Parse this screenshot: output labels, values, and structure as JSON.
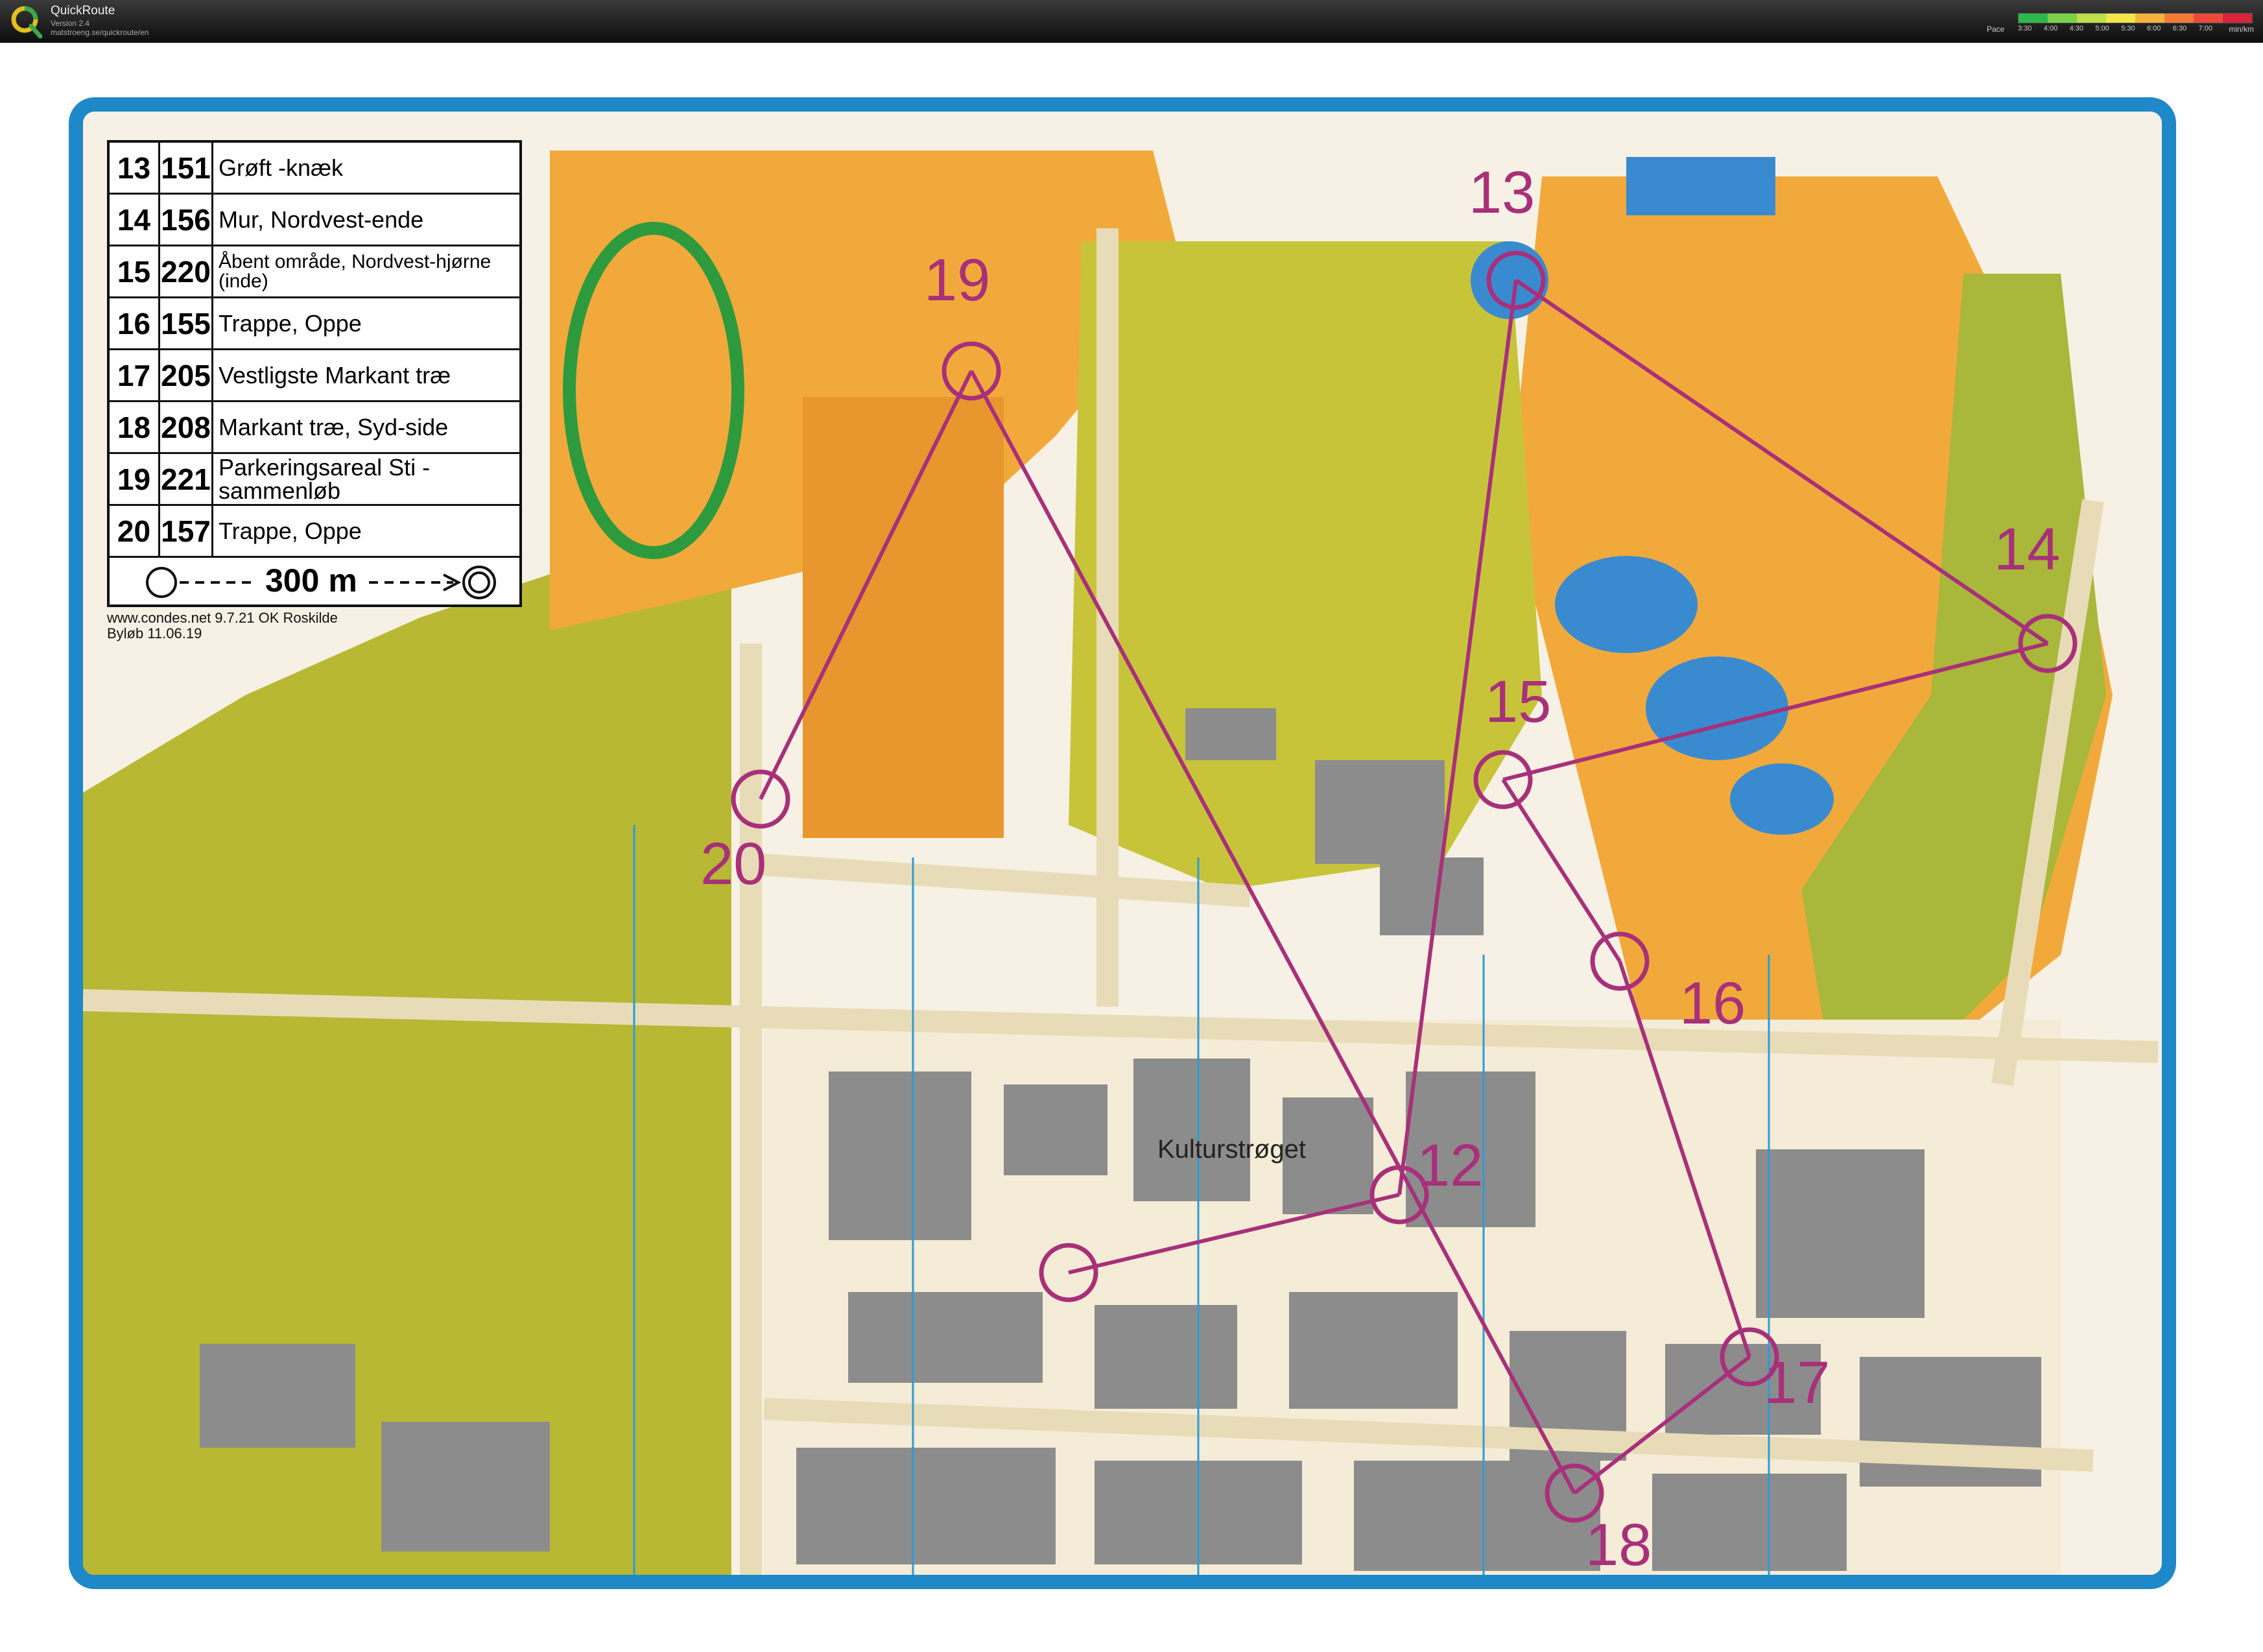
{
  "app": {
    "title": "QuickRoute",
    "version": "Version 2.4",
    "url": "matstroeng.se/quickroute/en"
  },
  "pace_legend": {
    "label": "Pace",
    "ticks": [
      "3:30",
      "4:00",
      "4:30",
      "5:00",
      "5:30",
      "6:00",
      "6:30",
      "7:00"
    ],
    "unit": "min/km",
    "colors": [
      "#2db84d",
      "#7ad14a",
      "#bde04a",
      "#f2e64a",
      "#f7b23b",
      "#f37a36",
      "#ea4a3a",
      "#d8233a"
    ]
  },
  "colors": {
    "frame_blue": "#1e88c8",
    "course_purple": "#a8307a",
    "open_orange": "#f2a93b",
    "forest_olive": "#b5b631",
    "building_gray": "#8c8c8c",
    "water_blue": "#3a8ad0"
  },
  "control_descriptions": [
    {
      "number": "13",
      "code": "151",
      "description": "Grøft -knæk"
    },
    {
      "number": "14",
      "code": "156",
      "description": "Mur, Nordvest-ende"
    },
    {
      "number": "15",
      "code": "220",
      "description": "Åbent område, Nordvest-hjørne (inde)"
    },
    {
      "number": "16",
      "code": "155",
      "description": "Trappe, Oppe"
    },
    {
      "number": "17",
      "code": "205",
      "description": "Vestligste Markant træ"
    },
    {
      "number": "18",
      "code": "208",
      "description": "Markant træ, Syd-side"
    },
    {
      "number": "19",
      "code": "221",
      "description": "Parkeringsareal Sti -sammenløb"
    },
    {
      "number": "20",
      "code": "157",
      "description": "Trappe, Oppe"
    }
  ],
  "leg_to_finish": "300 m",
  "credits": {
    "line1": "www.condes.net 9.7.21 OK Roskilde",
    "line2": "Byløb 11.06.19"
  },
  "map_labels": {
    "c12": "12",
    "c13": "13",
    "c14": "14",
    "c15": "15",
    "c16": "16",
    "c17": "17",
    "c18": "18",
    "c19": "19",
    "c20": "20",
    "street": "Kulturstrøget"
  }
}
